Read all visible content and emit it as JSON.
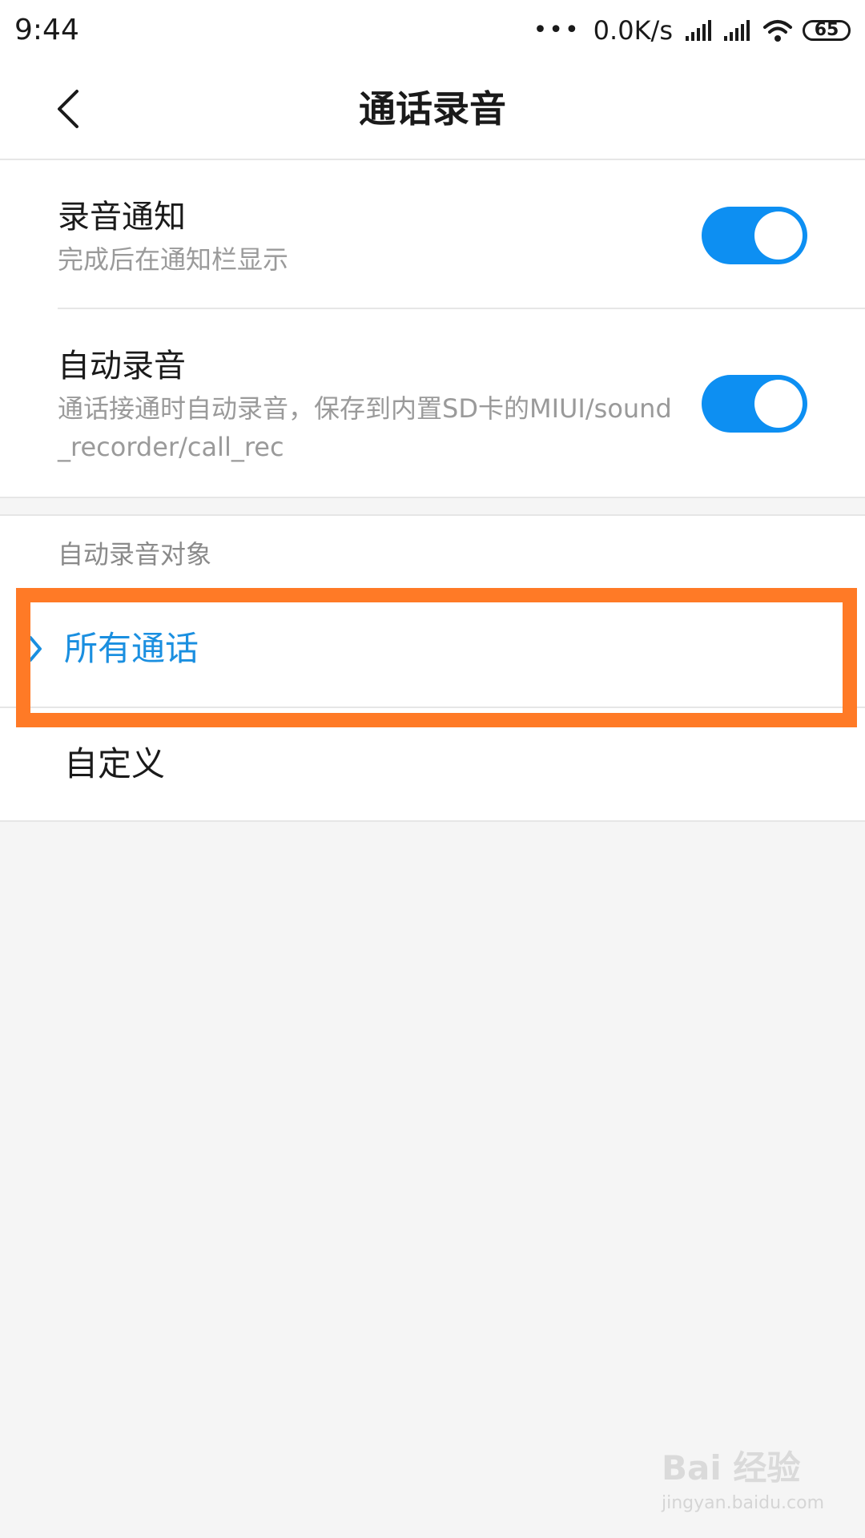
{
  "status_bar": {
    "time": "9:44",
    "dots": "•••",
    "speed": "0.0K/s",
    "battery": "65",
    "icons": [
      "signal-icon",
      "signal-icon",
      "wifi-icon",
      "battery-icon"
    ]
  },
  "header": {
    "title": "通话录音",
    "back_icon": "chevron-left-icon"
  },
  "settings": [
    {
      "title": "录音通知",
      "subtitle": "完成后在通知栏显示",
      "toggle_on": true
    },
    {
      "title": "自动录音",
      "subtitle": "通话接通时自动录音，保存到内置SD卡的MIUI/sound_recorder/call_rec",
      "toggle_on": true
    }
  ],
  "auto_record_target": {
    "section_label": "自动录音对象",
    "options": [
      {
        "label": "所有通话",
        "selected": true
      },
      {
        "label": "自定义",
        "selected": false
      }
    ]
  },
  "colors": {
    "accent": "#0d8ff2",
    "selected_text": "#1a8fe0",
    "highlight_frame": "#ff7a26",
    "background": "#f5f5f5"
  },
  "watermark": {
    "brand": "Bai 经验",
    "url": "jingyan.baidu.com"
  }
}
